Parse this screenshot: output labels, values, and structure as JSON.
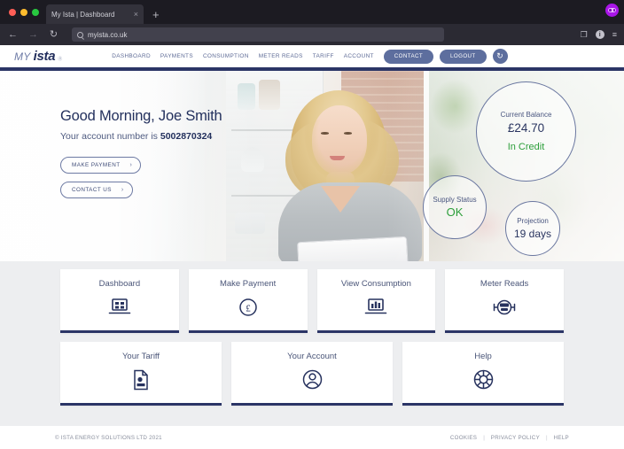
{
  "browser": {
    "tab_title": "My Ista | Dashboard",
    "tab_close": "×",
    "new_tab": "+",
    "back_icon": "←",
    "forward_icon": "→",
    "reload_icon": "↻",
    "url": "myista.co.uk",
    "save_icon": "❐",
    "account_icon": "i",
    "menu_icon": "≡"
  },
  "header": {
    "logo_my": "MY",
    "logo_ista": "ista",
    "logo_tm": "Ⓡ",
    "nav": [
      {
        "label": "DASHBOARD"
      },
      {
        "label": "PAYMENTS"
      },
      {
        "label": "CONSUMPTION"
      },
      {
        "label": "METER READS"
      },
      {
        "label": "TARIFF"
      },
      {
        "label": "ACCOUNT"
      }
    ],
    "contact_button": "CONTACT",
    "logout_button": "LOGOUT",
    "refresh_icon": "↻"
  },
  "hero": {
    "greeting": "Good Morning, Joe Smith",
    "account_prefix": "Your account number is ",
    "account_number": "5002870324",
    "make_payment_button": "MAKE PAYMENT",
    "contact_us_button": "CONTACT US",
    "chevron": "›",
    "circles": {
      "balance": {
        "label": "Current Balance",
        "value": "£24.70",
        "status": "In Credit"
      },
      "supply": {
        "label": "Supply Status",
        "status": "OK"
      },
      "projection": {
        "label": "Projection",
        "value": "19 days"
      }
    }
  },
  "cards": [
    {
      "title": "Dashboard",
      "icon": "laptop-grid-icon"
    },
    {
      "title": "Make Payment",
      "icon": "pound-coin-icon"
    },
    {
      "title": "View Consumption",
      "icon": "laptop-chart-icon"
    },
    {
      "title": "Meter Reads",
      "icon": "meter-icon"
    },
    {
      "title": "Your Tariff",
      "icon": "document-icon"
    },
    {
      "title": "Your Account",
      "icon": "user-circle-icon"
    },
    {
      "title": "Help",
      "icon": "lifebuoy-icon"
    }
  ],
  "footer": {
    "copyright": "© ISTA ENERGY SOLUTIONS LTD 2021",
    "links": [
      "COOKIES",
      "PRIVACY POLICY",
      "HELP"
    ],
    "separator": "|"
  },
  "colors": {
    "navy": "#2b3566",
    "slate_blue": "#5d6e9e",
    "credit_green": "#2c9e3a",
    "page_bg": "#edeef0"
  }
}
